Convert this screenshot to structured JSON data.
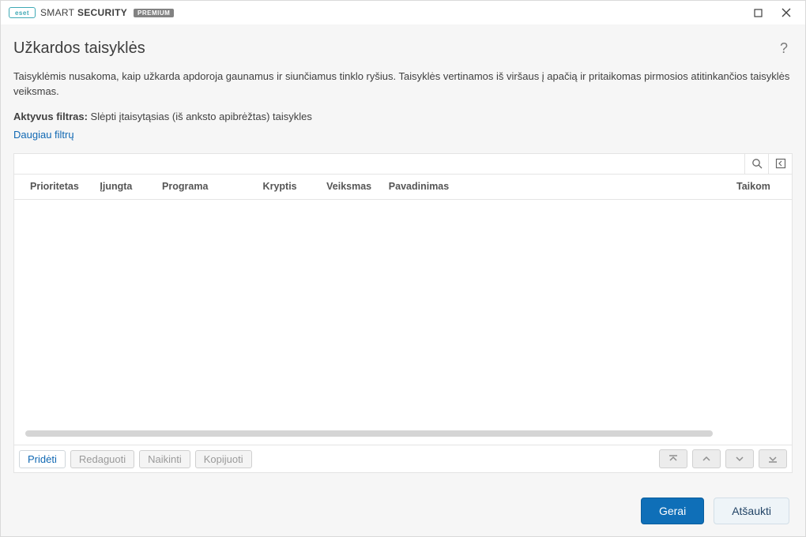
{
  "brand": {
    "logo_text": "eset",
    "name_light": "SMART",
    "name_bold": "SECURITY",
    "badge": "PREMIUM"
  },
  "page": {
    "title": "Užkardos taisyklės",
    "description": "Taisyklėmis nusakoma, kaip užkarda apdoroja gaunamus ir siunčiamus tinklo ryšius. Taisyklės vertinamos iš viršaus į apačią ir pritaikomas pirmosios atitinkančios taisyklės veiksmas.",
    "active_filter_label": "Aktyvus filtras:",
    "active_filter_value": "Slėpti įtaisytąsias (iš anksto apibrėžtas) taisykles",
    "more_filters": "Daugiau filtrų"
  },
  "table": {
    "columns": {
      "priority": "Prioritetas",
      "enabled": "Įjungta",
      "program": "Programa",
      "direction": "Kryptis",
      "action": "Veiksmas",
      "name": "Pavadinimas",
      "target": "Taikom"
    },
    "rows": []
  },
  "actions": {
    "add": "Pridėti",
    "edit": "Redaguoti",
    "delete": "Naikinti",
    "copy": "Kopijuoti"
  },
  "footer": {
    "ok": "Gerai",
    "cancel": "Atšaukti"
  }
}
